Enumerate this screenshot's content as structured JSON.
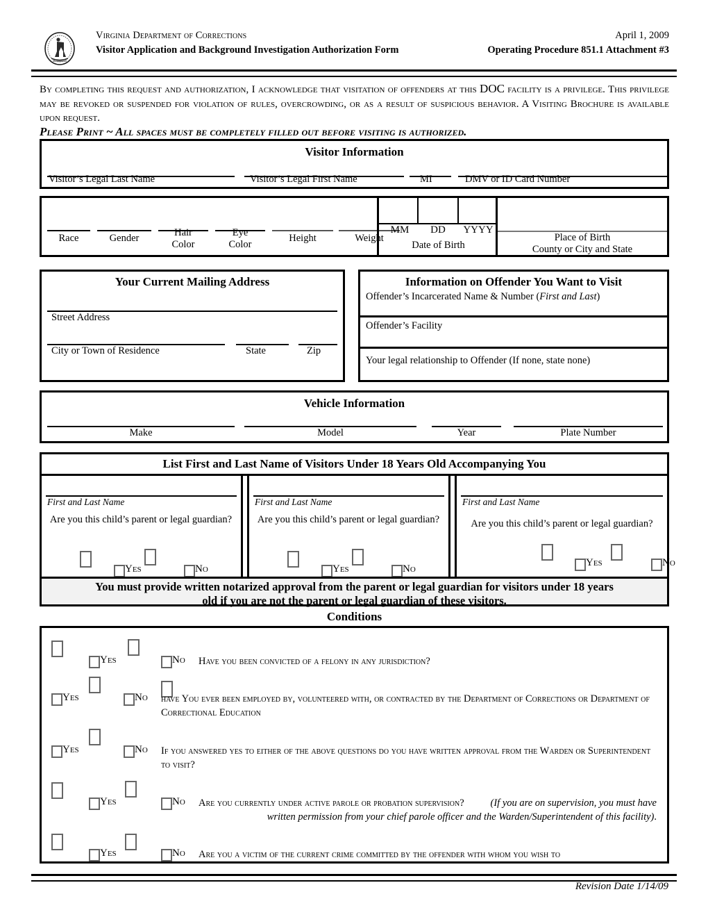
{
  "header": {
    "agency": "Virginia Department of Corrections",
    "form_title": "Visitor Application and Background Investigation Authorization Form",
    "date": "April 1, 2009",
    "procedure": "Operating Procedure 851.1  Attachment #3",
    "seal_icon": "state-seal-icon"
  },
  "intro": {
    "paragraph_1": "By completing this request and authorization, I acknowledge that visitation of offenders at this ",
    "doc_word": "DOC",
    "paragraph_2": " facility is a privilege.  This privilege may be revoked or suspended for violation of rules, overcrowding, or as a result of suspicious behavior.  A Visiting Brochure is available upon request.",
    "please_print": "Please Print ~ All spaces must be completely filled out before visiting is authorized."
  },
  "visitor_information": {
    "title": "Visitor Information",
    "fields": [
      {
        "label": "Visitor’s Legal Last Name",
        "value": ""
      },
      {
        "label": "Visitor’s Legal First Name",
        "value": ""
      },
      {
        "label": "MI",
        "value": ""
      },
      {
        "label": "DMV or ID Card Number",
        "value": ""
      }
    ]
  },
  "demographics": {
    "fields": [
      {
        "label": "Race",
        "value": ""
      },
      {
        "label": "Gender",
        "value": ""
      },
      {
        "label": "Hair\nColor",
        "line1": "Hair",
        "line2": "Color",
        "value": ""
      },
      {
        "label": "Eye\nColor",
        "line1": "Eye",
        "line2": "Color",
        "value": ""
      },
      {
        "label": "Height",
        "value": ""
      },
      {
        "label": "Weight",
        "value": ""
      }
    ],
    "date_of_birth": {
      "label": "Date of Birth",
      "mm": "MM",
      "dd": "DD",
      "yyyy": "YYYY",
      "mm_value": "",
      "dd_value": "",
      "yyyy_value": ""
    },
    "place_of_birth": {
      "line1": "Place of Birth",
      "line2": "County or City and State",
      "value": ""
    }
  },
  "mailing_address": {
    "title": "Your Current Mailing Address",
    "street_label": "Street Address",
    "street_value": "",
    "city_label": "City or Town of Residence",
    "city_value": "",
    "state_label": "State",
    "state_value": "",
    "zip_label": "Zip",
    "zip_value": ""
  },
  "offender_information": {
    "title": "Information on Offender You Want to Visit",
    "name_label": "Offender’s Incarcerated Name & Number (",
    "name_label_italic": "First and Last",
    "name_label_end": ")",
    "name_value": "",
    "facility_label": "Offender’s Facility",
    "facility_value": "",
    "relationship_label": "Your legal relationship to Offender (If none, state none)",
    "relationship_value": ""
  },
  "vehicle_information": {
    "title": "Vehicle Information",
    "fields": [
      {
        "label": "Make",
        "value": ""
      },
      {
        "label": "Model",
        "value": ""
      },
      {
        "label": "Year",
        "value": ""
      },
      {
        "label": "Plate Number",
        "value": ""
      }
    ]
  },
  "minors": {
    "title": "List First and Last Name of Visitors Under 18 Years Old Accompanying You",
    "columns": [
      {
        "name_label": "First and Last Name",
        "name_value": "",
        "question": "Are you this child’s parent or legal guardian?",
        "yes_label": "Yes",
        "no_label": "No",
        "yes_checked": false,
        "no_checked": false
      },
      {
        "name_label": "First and Last Name",
        "name_value": "",
        "question": "Are you this child’s parent or legal guardian?",
        "yes_label": "Yes",
        "no_label": "No",
        "yes_checked": false,
        "no_checked": false
      },
      {
        "name_label": "First and Last Name",
        "name_value": "",
        "question": "Are you this child’s parent or legal guardian?",
        "yes_label": "Yes",
        "no_label": "No",
        "yes_checked": false,
        "no_checked": false
      }
    ],
    "notice_line_1": "You must provide written notarized approval from the parent or legal guardian for visitors under 18 years",
    "notice_line_2": "old if you are not the parent or legal guardian of these visitors."
  },
  "conditions": {
    "title": "Conditions",
    "yes_label": "Yes",
    "no_label": "No",
    "questions": [
      {
        "text": "Have you been convicted of a felony in any jurisdiction?",
        "yes_checked": false,
        "no_checked": false
      },
      {
        "text": "have You ever been employed by, volunteered with, or contracted by the Department of Corrections or Department of Correctional Education",
        "yes_checked": false,
        "no_checked": false
      },
      {
        "text": "If you answered yes to either of the above questions do you have written approval from the Warden or Superintendent to visit?",
        "yes_checked": false,
        "no_checked": false
      },
      {
        "text": "Are you currently under active parole or probation supervision?  ",
        "italic_text": "(If you are on supervision, you must have written permission from your chief parole officer and the Warden/Superintendent of this facility)",
        "text_end": ".",
        "yes_checked": false,
        "no_checked": false
      },
      {
        "text": "Are you a victim of the current crime committed by the offender with whom you wish to",
        "yes_checked": false,
        "no_checked": false
      }
    ]
  },
  "footer": {
    "revision": "Revision Date 1/14/09"
  },
  "colors": {
    "ink": "#000000",
    "paper": "#ffffff",
    "notice_bg": "#f2f2f2",
    "checkbox_border": "#666666"
  }
}
